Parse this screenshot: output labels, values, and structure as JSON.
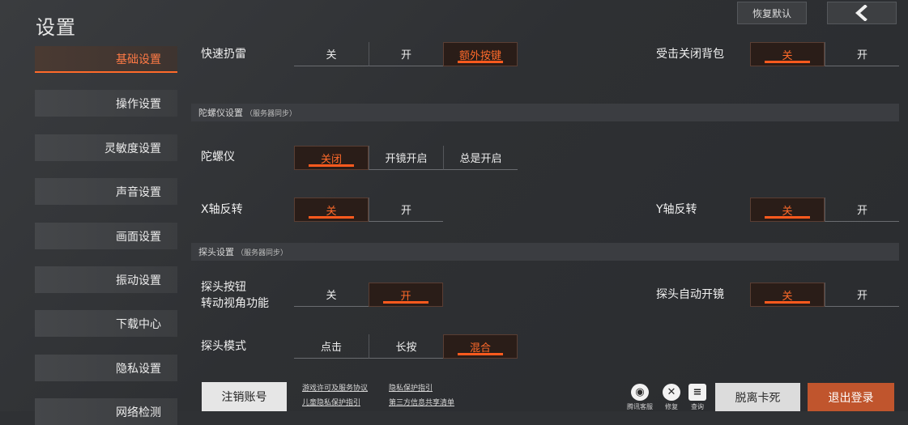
{
  "page_title": "设置",
  "top": {
    "reset_label": "恢复默认"
  },
  "sidebar": {
    "items": [
      {
        "label": "基础设置"
      },
      {
        "label": "操作设置"
      },
      {
        "label": "灵敏度设置"
      },
      {
        "label": "声音设置"
      },
      {
        "label": "画面设置"
      },
      {
        "label": "振动设置"
      },
      {
        "label": "下载中心"
      },
      {
        "label": "隐私设置"
      },
      {
        "label": "网络检测"
      }
    ]
  },
  "settings": {
    "quick_throw": {
      "label": "快速扔雷",
      "options": [
        "关",
        "开",
        "额外按键"
      ],
      "selected": "额外按键"
    },
    "hit_close_bag": {
      "label": "受击关闭背包",
      "options": [
        "关",
        "开"
      ],
      "selected": "关"
    },
    "gyro_section": {
      "title": "陀螺仪设置",
      "note": "（服务器同步）"
    },
    "gyro": {
      "label": "陀螺仪",
      "options": [
        "关闭",
        "开镜开启",
        "总是开启"
      ],
      "selected": "关闭"
    },
    "x_invert": {
      "label": "X轴反转",
      "options": [
        "关",
        "开"
      ],
      "selected": "关"
    },
    "y_invert": {
      "label": "Y轴反转",
      "options": [
        "关",
        "开"
      ],
      "selected": "关"
    },
    "peek_section": {
      "title": "探头设置",
      "note": "（服务器同步）"
    },
    "peek_button": {
      "label_line1": "探头按钮",
      "label_line2": "转动视角功能",
      "options": [
        "关",
        "开"
      ],
      "selected": "开"
    },
    "peek_auto_scope": {
      "label": "探头自动开镜",
      "options": [
        "关",
        "开"
      ],
      "selected": "关"
    },
    "peek_mode": {
      "label": "探头模式",
      "options": [
        "点击",
        "长按",
        "混合"
      ],
      "selected": "混合"
    }
  },
  "bottom": {
    "cancel_account": "注销账号",
    "links": [
      "游戏许可及服务协议",
      "隐私保护指引",
      "儿童隐私保护指引",
      "第三方信息共享清单"
    ],
    "icons": [
      {
        "caption": "腾讯客服",
        "icon": "support-icon"
      },
      {
        "caption": "修复",
        "icon": "repair-icon"
      },
      {
        "caption": "查询",
        "icon": "query-icon"
      }
    ],
    "escape_stuck": "脱离卡死",
    "logout": "退出登录"
  },
  "colors": {
    "accent": "#ff6a2a",
    "logout": "#c0552d"
  }
}
